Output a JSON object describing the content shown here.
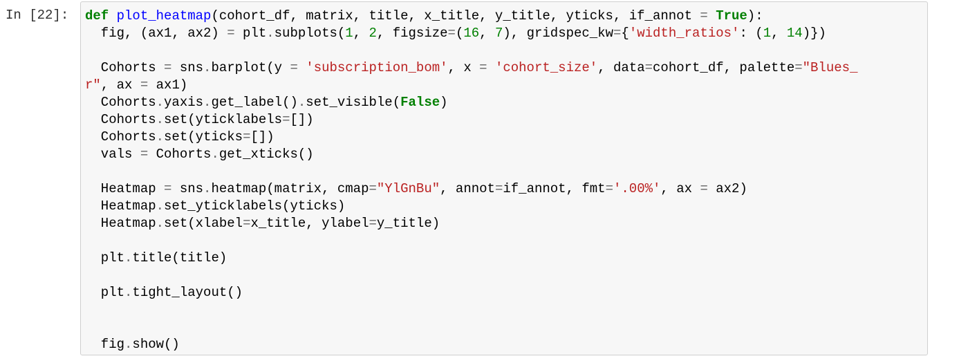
{
  "prompt": "In [22]:",
  "code": {
    "lines": [
      [
        {
          "t": "def",
          "c": "kw"
        },
        {
          "t": " "
        },
        {
          "t": "plot_heatmap",
          "c": "fn"
        },
        {
          "t": "(cohort_df, matrix, title, x_title, y_title, yticks, if_annot "
        },
        {
          "t": "=",
          "c": "op"
        },
        {
          "t": " "
        },
        {
          "t": "True",
          "c": "kw"
        },
        {
          "t": "):"
        }
      ],
      [
        {
          "t": "  fig, (ax1, ax2) "
        },
        {
          "t": "=",
          "c": "op"
        },
        {
          "t": " plt"
        },
        {
          "t": ".",
          "c": "op"
        },
        {
          "t": "subplots("
        },
        {
          "t": "1",
          "c": "num"
        },
        {
          "t": ", "
        },
        {
          "t": "2",
          "c": "num"
        },
        {
          "t": ", figsize"
        },
        {
          "t": "=",
          "c": "op"
        },
        {
          "t": "("
        },
        {
          "t": "16",
          "c": "num"
        },
        {
          "t": ", "
        },
        {
          "t": "7",
          "c": "num"
        },
        {
          "t": "), gridspec_kw"
        },
        {
          "t": "=",
          "c": "op"
        },
        {
          "t": "{"
        },
        {
          "t": "'width_ratios'",
          "c": "str"
        },
        {
          "t": ": ("
        },
        {
          "t": "1",
          "c": "num"
        },
        {
          "t": ", "
        },
        {
          "t": "14",
          "c": "num"
        },
        {
          "t": ")})"
        }
      ],
      [],
      [
        {
          "t": "  Cohorts "
        },
        {
          "t": "=",
          "c": "op"
        },
        {
          "t": " sns"
        },
        {
          "t": ".",
          "c": "op"
        },
        {
          "t": "barplot(y "
        },
        {
          "t": "=",
          "c": "op"
        },
        {
          "t": " "
        },
        {
          "t": "'subscription_bom'",
          "c": "str"
        },
        {
          "t": ", x "
        },
        {
          "t": "=",
          "c": "op"
        },
        {
          "t": " "
        },
        {
          "t": "'cohort_size'",
          "c": "str"
        },
        {
          "t": ", data"
        },
        {
          "t": "=",
          "c": "op"
        },
        {
          "t": "cohort_df, palette"
        },
        {
          "t": "=",
          "c": "op"
        },
        {
          "t": "\"Blues_",
          "c": "str"
        }
      ],
      [
        {
          "t": "r\"",
          "c": "str"
        },
        {
          "t": ", ax "
        },
        {
          "t": "=",
          "c": "op"
        },
        {
          "t": " ax1)"
        }
      ],
      [
        {
          "t": "  Cohorts"
        },
        {
          "t": ".",
          "c": "op"
        },
        {
          "t": "yaxis"
        },
        {
          "t": ".",
          "c": "op"
        },
        {
          "t": "get_label()"
        },
        {
          "t": ".",
          "c": "op"
        },
        {
          "t": "set_visible("
        },
        {
          "t": "False",
          "c": "kw"
        },
        {
          "t": ")"
        }
      ],
      [
        {
          "t": "  Cohorts"
        },
        {
          "t": ".",
          "c": "op"
        },
        {
          "t": "set(yticklabels"
        },
        {
          "t": "=",
          "c": "op"
        },
        {
          "t": "[])"
        }
      ],
      [
        {
          "t": "  Cohorts"
        },
        {
          "t": ".",
          "c": "op"
        },
        {
          "t": "set(yticks"
        },
        {
          "t": "=",
          "c": "op"
        },
        {
          "t": "[])"
        }
      ],
      [
        {
          "t": "  vals "
        },
        {
          "t": "=",
          "c": "op"
        },
        {
          "t": " Cohorts"
        },
        {
          "t": ".",
          "c": "op"
        },
        {
          "t": "get_xticks()"
        }
      ],
      [],
      [
        {
          "t": "  Heatmap "
        },
        {
          "t": "=",
          "c": "op"
        },
        {
          "t": " sns"
        },
        {
          "t": ".",
          "c": "op"
        },
        {
          "t": "heatmap(matrix, cmap"
        },
        {
          "t": "=",
          "c": "op"
        },
        {
          "t": "\"YlGnBu\"",
          "c": "str"
        },
        {
          "t": ", annot"
        },
        {
          "t": "=",
          "c": "op"
        },
        {
          "t": "if_annot, fmt"
        },
        {
          "t": "=",
          "c": "op"
        },
        {
          "t": "'.00%'",
          "c": "str"
        },
        {
          "t": ", ax "
        },
        {
          "t": "=",
          "c": "op"
        },
        {
          "t": " ax2)"
        }
      ],
      [
        {
          "t": "  Heatmap"
        },
        {
          "t": ".",
          "c": "op"
        },
        {
          "t": "set_yticklabels(yticks)"
        }
      ],
      [
        {
          "t": "  Heatmap"
        },
        {
          "t": ".",
          "c": "op"
        },
        {
          "t": "set(xlabel"
        },
        {
          "t": "=",
          "c": "op"
        },
        {
          "t": "x_title, ylabel"
        },
        {
          "t": "=",
          "c": "op"
        },
        {
          "t": "y_title)"
        }
      ],
      [],
      [
        {
          "t": "  plt"
        },
        {
          "t": ".",
          "c": "op"
        },
        {
          "t": "title(title)"
        }
      ],
      [],
      [
        {
          "t": "  plt"
        },
        {
          "t": ".",
          "c": "op"
        },
        {
          "t": "tight_layout()"
        }
      ],
      [],
      [],
      [
        {
          "t": "  fig"
        },
        {
          "t": ".",
          "c": "op"
        },
        {
          "t": "show()"
        }
      ]
    ]
  },
  "colors": {
    "keyword": "#008000",
    "string": "#ba2121",
    "number": "#008000",
    "function": "#0000ff",
    "operator": "#666666",
    "cell_background": "#f7f7f7",
    "cell_border": "#cfcfcf"
  }
}
